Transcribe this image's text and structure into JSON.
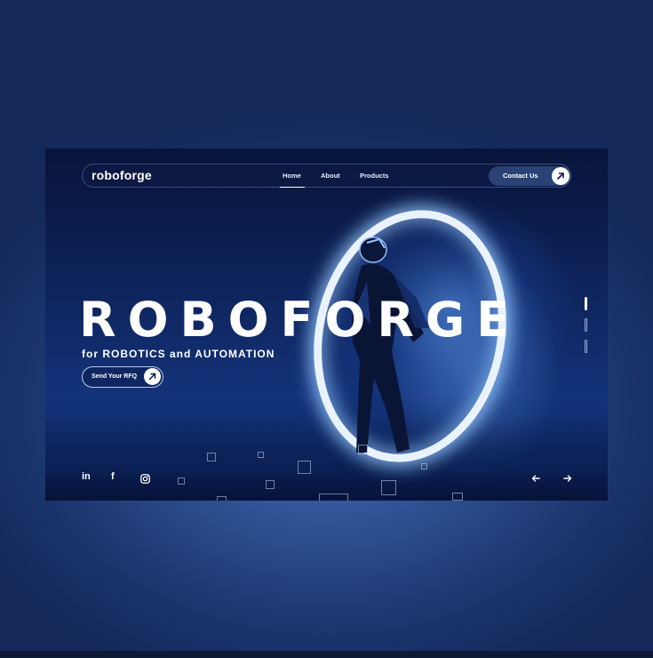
{
  "nav": {
    "logo": "roboforge",
    "links": [
      "Home",
      "About",
      "Products"
    ],
    "contact_label": "Contact Us"
  },
  "hero": {
    "title": "ROBOFORGE",
    "subtitle": "for ROBOTICS and AUTOMATION",
    "cta_label": "Send Your RFQ"
  },
  "social": {
    "icons": [
      "linkedin-icon",
      "facebook-icon",
      "instagram-icon"
    ],
    "linkedin": "in",
    "facebook": "f"
  },
  "slider": {
    "prev_icon": "arrow-left-icon",
    "next_icon": "arrow-right-icon",
    "active_index": 1,
    "count": 3
  },
  "colors": {
    "accent": "#ffffff",
    "background_dark": "#0a1a45",
    "glow": "#9cc8ff"
  }
}
